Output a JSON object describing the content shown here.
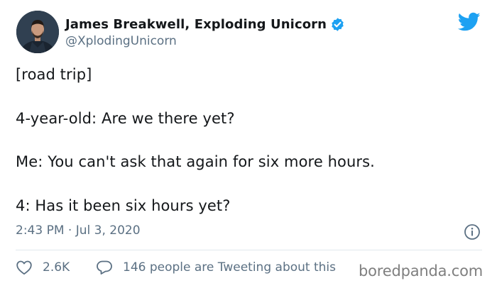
{
  "author": {
    "name": "James Breakwell, Exploding Unicorn",
    "handle": "@XplodingUnicorn",
    "verified": true
  },
  "tweet": {
    "lines": [
      "[road trip]",
      "4-year-old: Are we there yet?",
      "Me: You can't ask that again for six more hours.",
      "4: Has it been six hours yet?"
    ],
    "timestamp": "2:43 PM · Jul 3, 2020"
  },
  "actions": {
    "likes": "2.6K",
    "tweeting": "146 people are Tweeting about this"
  },
  "watermark": "boredpanda.com",
  "icons": {
    "logo": "twitter-bird-icon",
    "verified": "verified-badge-icon",
    "info": "info-icon",
    "like": "heart-icon",
    "reply": "speech-bubble-icon"
  },
  "colors": {
    "twitter_blue": "#1da1f2",
    "secondary_text": "#5b7083",
    "primary_text": "#14171a"
  }
}
